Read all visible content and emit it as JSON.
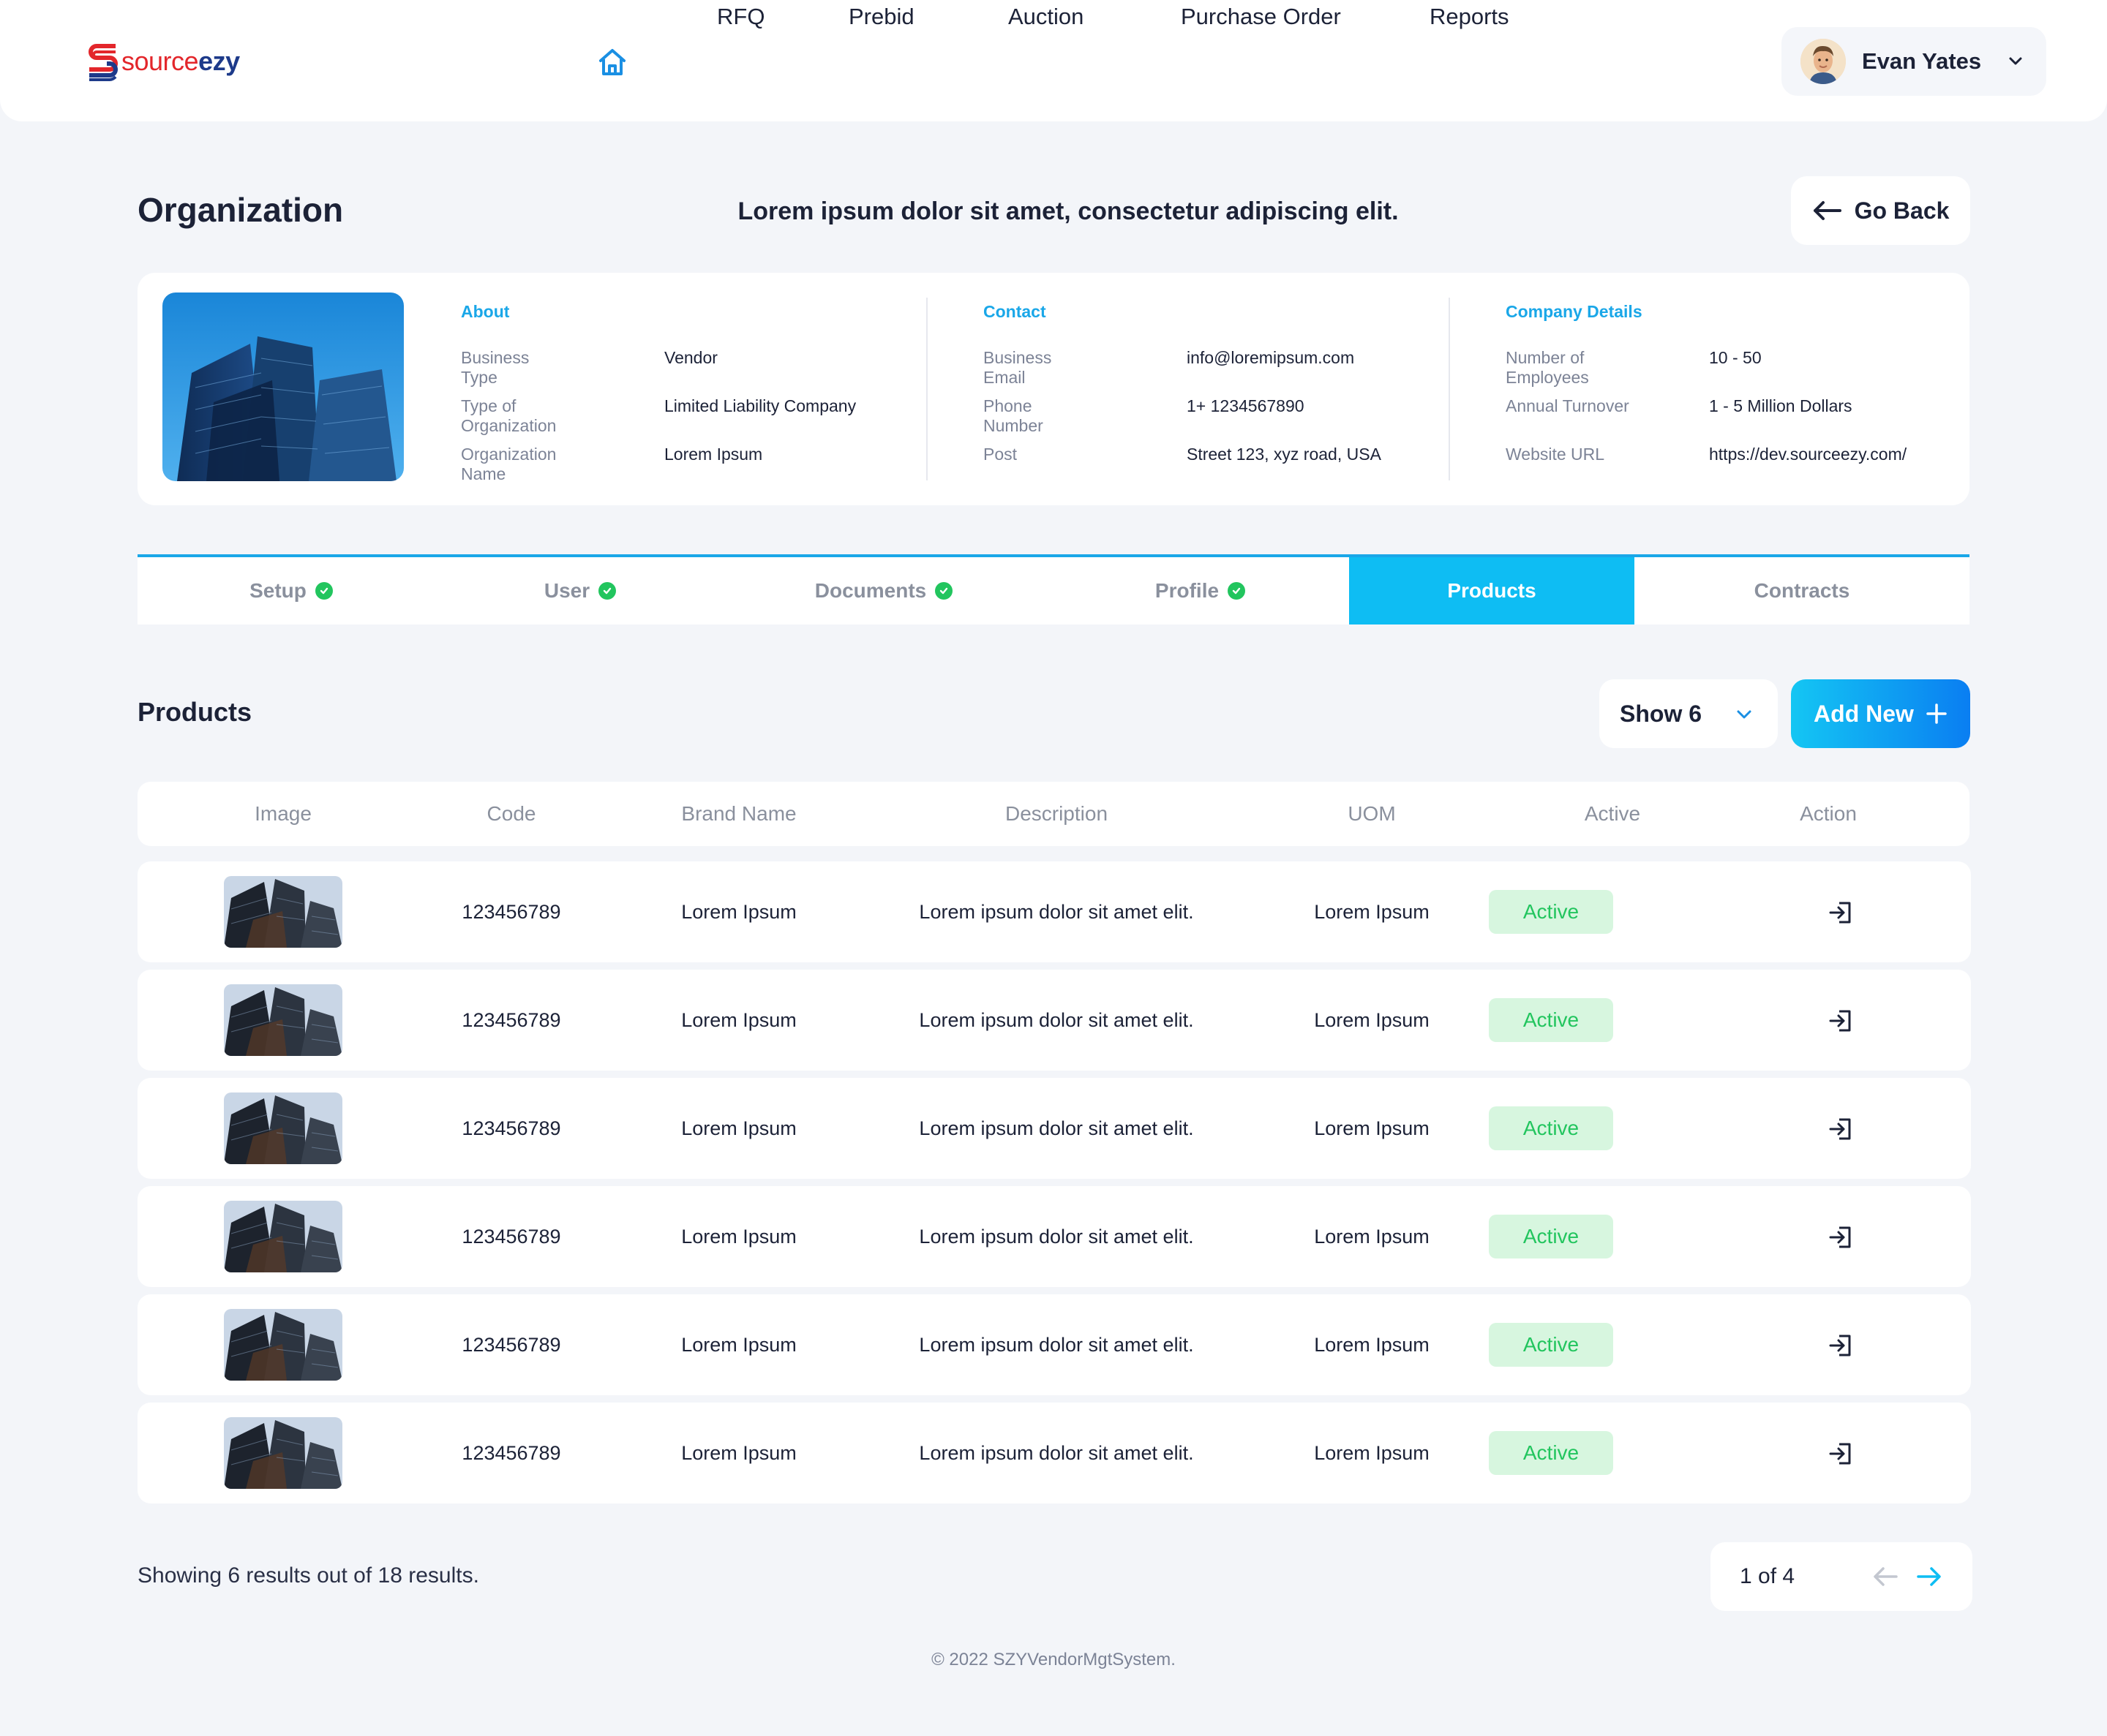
{
  "app": {
    "logo_text_part1": "source",
    "logo_text_part2": "ezy"
  },
  "nav": {
    "items": [
      "RFQ",
      "Prebid",
      "Auction",
      "Purchase Order",
      "Reports"
    ],
    "user_name": "Evan Yates"
  },
  "header": {
    "title": "Organization",
    "subtitle": "Lorem ipsum dolor sit amet, consectetur adipiscing elit.",
    "go_back": "Go Back"
  },
  "org": {
    "about": {
      "heading": "About",
      "rows": [
        {
          "label": "Business Type",
          "value": "Vendor"
        },
        {
          "label": "Type of Organization",
          "value": "Limited Liability Company"
        },
        {
          "label": "Organization Name",
          "value": "Lorem Ipsum"
        }
      ]
    },
    "contact": {
      "heading": "Contact",
      "rows": [
        {
          "label": "Business Email",
          "value": "info@loremipsum.com"
        },
        {
          "label": "Phone Number",
          "value": "1+ 1234567890"
        },
        {
          "label": "Post",
          "value": "Street 123, xyz road, USA"
        }
      ]
    },
    "company": {
      "heading": "Company Details",
      "rows": [
        {
          "label": "Number of Employees",
          "value": "10 - 50"
        },
        {
          "label": "Annual Turnover",
          "value": "1 - 5 Million Dollars"
        },
        {
          "label": "Website URL",
          "value": "https://dev.sourceezy.com/"
        }
      ]
    }
  },
  "tabs": [
    {
      "label": "Setup",
      "done": true
    },
    {
      "label": "User",
      "done": true
    },
    {
      "label": "Documents",
      "done": true
    },
    {
      "label": "Profile",
      "done": true
    },
    {
      "label": "Products",
      "active": true
    },
    {
      "label": "Contracts"
    }
  ],
  "products": {
    "title": "Products",
    "show_label": "Show 6",
    "add_new": "Add New",
    "columns": [
      "Image",
      "Code",
      "Brand Name",
      "Description",
      "UOM",
      "Active",
      "Action"
    ],
    "rows": [
      {
        "code": "123456789",
        "brand": "Lorem Ipsum",
        "description": "Lorem ipsum dolor sit amet elit.",
        "uom": "Lorem Ipsum",
        "status": "Active"
      },
      {
        "code": "123456789",
        "brand": "Lorem Ipsum",
        "description": "Lorem ipsum dolor sit amet elit.",
        "uom": "Lorem Ipsum",
        "status": "Active"
      },
      {
        "code": "123456789",
        "brand": "Lorem Ipsum",
        "description": "Lorem ipsum dolor sit amet elit.",
        "uom": "Lorem Ipsum",
        "status": "Active"
      },
      {
        "code": "123456789",
        "brand": "Lorem Ipsum",
        "description": "Lorem ipsum dolor sit amet elit.",
        "uom": "Lorem Ipsum",
        "status": "Active"
      },
      {
        "code": "123456789",
        "brand": "Lorem Ipsum",
        "description": "Lorem ipsum dolor sit amet elit.",
        "uom": "Lorem Ipsum",
        "status": "Active"
      },
      {
        "code": "123456789",
        "brand": "Lorem Ipsum",
        "description": "Lorem ipsum dolor sit amet elit.",
        "uom": "Lorem Ipsum",
        "status": "Active"
      }
    ],
    "showing": "Showing 6 results out of 18 results.",
    "pagination": "1 of 4"
  },
  "footer": {
    "copyright": "© 2022 SZYVendorMgtSystem."
  },
  "colors": {
    "accent": "#0ebdf3",
    "success": "#22c55e",
    "success_bg": "#d7f6df",
    "brand_red": "#e3262b",
    "brand_blue": "#1d3a8a"
  },
  "icons": [
    "home-icon",
    "chevron-down-icon",
    "arrow-left-icon",
    "check-icon",
    "plus-icon",
    "enter-icon",
    "arrow-right-icon"
  ]
}
